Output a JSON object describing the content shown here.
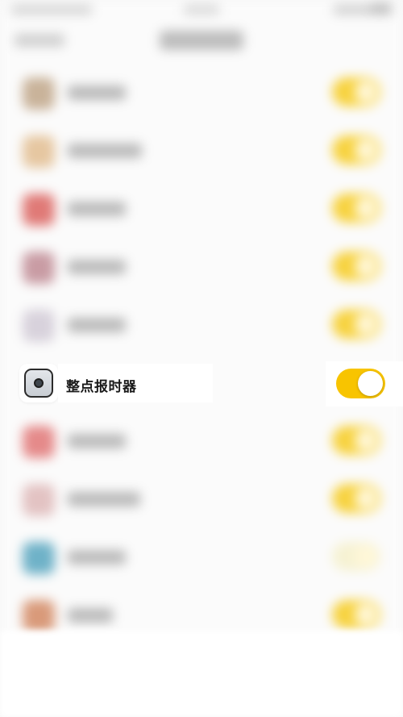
{
  "focused_item": {
    "label": "整点报时器",
    "toggle_on": true,
    "icon": "camera-icon"
  },
  "colors": {
    "toggle_on": "#f8c400",
    "label": "#1a1a1a",
    "background": "#f7f7f7"
  }
}
